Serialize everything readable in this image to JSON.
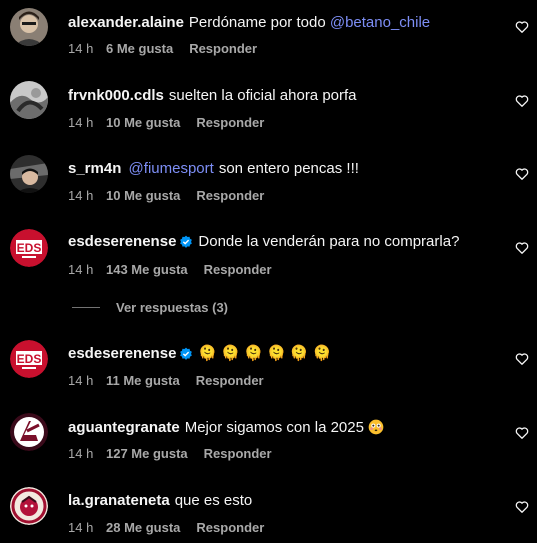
{
  "comments": [
    {
      "username": "alexander.alaine",
      "text": "Perdóname por todo",
      "mention": "@betano_chile",
      "time": "14 h",
      "likes": "6 Me gusta",
      "reply": "Responder"
    },
    {
      "username": "frvnk000.cdls",
      "text": "suelten la oficial ahora porfa",
      "time": "14 h",
      "likes": "10 Me gusta",
      "reply": "Responder"
    },
    {
      "username": "s_rm4n",
      "mention": "@fiumesport",
      "text": "son entero pencas !!!",
      "time": "14 h",
      "likes": "10 Me gusta",
      "reply": "Responder"
    },
    {
      "username": "esdeserenense",
      "text": "Donde la venderán para no comprarla?",
      "time": "14 h",
      "likes": "143 Me gusta",
      "reply": "Responder"
    },
    {
      "username": "esdeserenense",
      "text": "🫠 🫠 🫠 🫠 🫠 🫠",
      "time": "14 h",
      "likes": "11 Me gusta",
      "reply": "Responder"
    },
    {
      "username": "aguantegranate",
      "text": "Mejor sigamos con la 2025",
      "time": "14 h",
      "likes": "127 Me gusta",
      "reply": "Responder"
    },
    {
      "username": "la.granateneta",
      "text": "que es esto",
      "time": "14 h",
      "likes": "28 Me gusta",
      "reply": "Responder"
    }
  ],
  "view_replies": "Ver respuestas (3)",
  "colors": {
    "background": "#000000",
    "text": "#f5f5f5",
    "secondary": "#a8a8a8",
    "mention": "#7d8ef5",
    "verified": "#0095f6",
    "eds_red": "#c8102e"
  },
  "icons": {
    "like": "heart-outline-icon",
    "verified": "verified-badge-icon",
    "melting": "melting-face-emoji",
    "flushed": "flushed-face-emoji"
  }
}
